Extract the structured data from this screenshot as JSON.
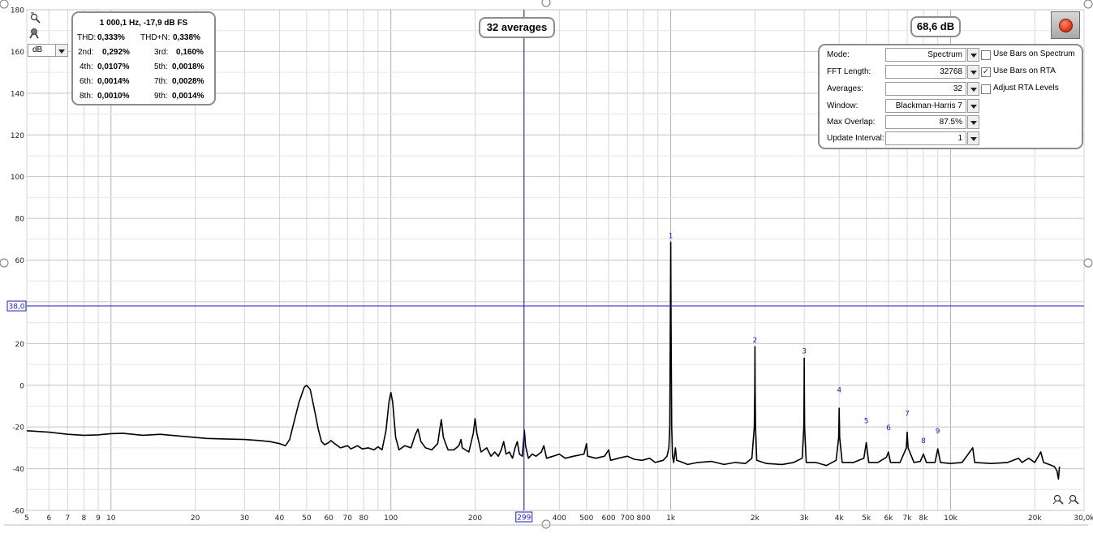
{
  "stats": {
    "title": "1 000,1 Hz, -17,9 dB FS",
    "rows": [
      {
        "l1": "THD:",
        "v1": "0,333%",
        "l2": "THD+N:",
        "v2": "0,338%"
      },
      {
        "l1": "2nd:",
        "v1": "0,292%",
        "l2": "3rd:",
        "v2": "0,160%"
      },
      {
        "l1": "4th:",
        "v1": "0,0107%",
        "l2": "5th:",
        "v2": "0,0018%"
      },
      {
        "l1": "6th:",
        "v1": "0,0014%",
        "l2": "7th:",
        "v2": "0,0028%"
      },
      {
        "l1": "8th:",
        "v1": "0,0010%",
        "l2": "9th:",
        "v2": "0,0014%"
      }
    ]
  },
  "averages_label": "32 averages",
  "level_label": "68,6 dB",
  "unit_select": "dB",
  "settings": {
    "mode": {
      "label": "Mode:",
      "value": "Spectrum"
    },
    "fft_length": {
      "label": "FFT Length:",
      "value": "32768"
    },
    "averages": {
      "label": "Averages:",
      "value": "32"
    },
    "window": {
      "label": "Window:",
      "value": "Blackman-Harris 7"
    },
    "max_overlap": {
      "label": "Max Overlap:",
      "value": "87.5%"
    },
    "update_interval": {
      "label": "Update Interval:",
      "value": "1"
    },
    "use_bars_spectrum": {
      "label": "Use Bars on Spectrum",
      "checked": false
    },
    "use_bars_rta": {
      "label": "Use Bars on RTA",
      "checked": true
    },
    "adjust_rta": {
      "label": "Adjust RTA Levels",
      "checked": false
    }
  },
  "cursor": {
    "x_label": "299",
    "y_label": "38,0",
    "x_value": 299,
    "y_value": 38.0
  },
  "chart_data": {
    "type": "line",
    "x_scale": "log",
    "xlim": [
      5,
      30000
    ],
    "ylim": [
      -60,
      180
    ],
    "grid": true,
    "y_ticks": [
      {
        "v": 180,
        "label": "180"
      },
      {
        "v": 160,
        "label": "160"
      },
      {
        "v": 140,
        "label": "140"
      },
      {
        "v": 120,
        "label": "120"
      },
      {
        "v": 100,
        "label": "100"
      },
      {
        "v": 80,
        "label": "80"
      },
      {
        "v": 60,
        "label": "60"
      },
      {
        "v": 20,
        "label": "20"
      },
      {
        "v": 0,
        "label": "0"
      },
      {
        "v": -20,
        "label": "-20"
      },
      {
        "v": -40,
        "label": "-40"
      },
      {
        "v": -60,
        "label": "-60"
      }
    ],
    "x_ticks": [
      {
        "v": 5,
        "label": "5"
      },
      {
        "v": 6,
        "label": "6"
      },
      {
        "v": 7,
        "label": "7"
      },
      {
        "v": 8,
        "label": "8"
      },
      {
        "v": 9,
        "label": "9"
      },
      {
        "v": 10,
        "label": "10"
      },
      {
        "v": 20,
        "label": "20"
      },
      {
        "v": 30,
        "label": "30"
      },
      {
        "v": 40,
        "label": "40"
      },
      {
        "v": 50,
        "label": "50"
      },
      {
        "v": 60,
        "label": "60"
      },
      {
        "v": 70,
        "label": "70"
      },
      {
        "v": 80,
        "label": "80"
      },
      {
        "v": 100,
        "label": "100"
      },
      {
        "v": 200,
        "label": "200"
      },
      {
        "v": 400,
        "label": "400"
      },
      {
        "v": 500,
        "label": "500"
      },
      {
        "v": 600,
        "label": "600"
      },
      {
        "v": 700,
        "label": "700"
      },
      {
        "v": 800,
        "label": "800"
      },
      {
        "v": 1000,
        "label": "1k"
      },
      {
        "v": 2000,
        "label": "2k"
      },
      {
        "v": 3000,
        "label": "3k"
      },
      {
        "v": 4000,
        "label": "4k"
      },
      {
        "v": 5000,
        "label": "5k"
      },
      {
        "v": 6000,
        "label": "6k"
      },
      {
        "v": 7000,
        "label": "7k"
      },
      {
        "v": 8000,
        "label": "8k"
      },
      {
        "v": 10000,
        "label": "10k"
      },
      {
        "v": 20000,
        "label": "20k"
      },
      {
        "v": 30000,
        "label": "30,0k"
      }
    ],
    "series": [
      {
        "color": "#000000",
        "points": [
          [
            5,
            -21.8
          ],
          [
            6,
            -22.5
          ],
          [
            7,
            -23.5
          ],
          [
            8,
            -24
          ],
          [
            9,
            -23.8
          ],
          [
            10,
            -23.2
          ],
          [
            11,
            -23
          ],
          [
            13,
            -24
          ],
          [
            15,
            -23.5
          ],
          [
            18,
            -24.5
          ],
          [
            22,
            -25.5
          ],
          [
            26,
            -25.8
          ],
          [
            30,
            -26
          ],
          [
            34,
            -26.5
          ],
          [
            37,
            -27
          ],
          [
            40,
            -28
          ],
          [
            42,
            -29
          ],
          [
            43.5,
            -26
          ],
          [
            45,
            -18
          ],
          [
            47,
            -8
          ],
          [
            49,
            -1
          ],
          [
            50,
            0
          ],
          [
            51.5,
            -2
          ],
          [
            53,
            -10
          ],
          [
            55,
            -21
          ],
          [
            56.5,
            -27
          ],
          [
            58,
            -28.5
          ],
          [
            60,
            -27.5
          ],
          [
            61,
            -26.5
          ],
          [
            63,
            -28
          ],
          [
            66,
            -30
          ],
          [
            70,
            -29
          ],
          [
            72,
            -30.5
          ],
          [
            76,
            -29
          ],
          [
            79,
            -30.5
          ],
          [
            83,
            -30
          ],
          [
            87,
            -31
          ],
          [
            90,
            -29.5
          ],
          [
            93,
            -31
          ],
          [
            96,
            -22
          ],
          [
            98.5,
            -8
          ],
          [
            100,
            -3.5
          ],
          [
            101.5,
            -8
          ],
          [
            104,
            -25
          ],
          [
            107,
            -31
          ],
          [
            112,
            -29
          ],
          [
            118,
            -30
          ],
          [
            122,
            -24
          ],
          [
            125,
            -21
          ],
          [
            128,
            -27
          ],
          [
            133,
            -30
          ],
          [
            140,
            -31
          ],
          [
            147,
            -28
          ],
          [
            150,
            -20
          ],
          [
            151.5,
            -16.5
          ],
          [
            154,
            -25
          ],
          [
            160,
            -31
          ],
          [
            168,
            -31
          ],
          [
            175,
            -29
          ],
          [
            178,
            -26
          ],
          [
            180,
            -30
          ],
          [
            190,
            -32
          ],
          [
            197,
            -23
          ],
          [
            200,
            -16
          ],
          [
            203,
            -23
          ],
          [
            210,
            -32
          ],
          [
            220,
            -30
          ],
          [
            228,
            -34
          ],
          [
            235,
            -32
          ],
          [
            242,
            -34
          ],
          [
            248,
            -31
          ],
          [
            253,
            -27
          ],
          [
            258,
            -33
          ],
          [
            265,
            -32
          ],
          [
            272,
            -35
          ],
          [
            278,
            -30
          ],
          [
            283,
            -27
          ],
          [
            288,
            -33
          ],
          [
            295,
            -34
          ],
          [
            300,
            -21.5
          ],
          [
            303,
            -29
          ],
          [
            310,
            -35
          ],
          [
            320,
            -33
          ],
          [
            330,
            -34
          ],
          [
            345,
            -32
          ],
          [
            352,
            -29
          ],
          [
            360,
            -35
          ],
          [
            380,
            -34
          ],
          [
            400,
            -33
          ],
          [
            420,
            -35
          ],
          [
            450,
            -34
          ],
          [
            490,
            -33
          ],
          [
            500,
            -28
          ],
          [
            505,
            -34
          ],
          [
            540,
            -35
          ],
          [
            580,
            -34
          ],
          [
            600,
            -31
          ],
          [
            610,
            -36
          ],
          [
            650,
            -35
          ],
          [
            700,
            -34
          ],
          [
            740,
            -35.5
          ],
          [
            790,
            -36
          ],
          [
            840,
            -35
          ],
          [
            880,
            -37
          ],
          [
            940,
            -36
          ],
          [
            970,
            -34
          ],
          [
            985,
            -30
          ],
          [
            992,
            -20
          ],
          [
            997,
            30
          ],
          [
            1000,
            68.6
          ],
          [
            1003,
            30
          ],
          [
            1008,
            -20
          ],
          [
            1015,
            -34
          ],
          [
            1025,
            -37
          ],
          [
            1040,
            -30
          ],
          [
            1050,
            -36
          ],
          [
            1080,
            -36.5
          ],
          [
            1150,
            -38
          ],
          [
            1250,
            -37
          ],
          [
            1400,
            -36.5
          ],
          [
            1550,
            -38
          ],
          [
            1700,
            -37
          ],
          [
            1850,
            -37.5
          ],
          [
            1950,
            -35
          ],
          [
            1990,
            -20
          ],
          [
            1997,
            0
          ],
          [
            2000,
            18.5
          ],
          [
            2003,
            0
          ],
          [
            2010,
            -20
          ],
          [
            2030,
            -36
          ],
          [
            2200,
            -37.5
          ],
          [
            2500,
            -38
          ],
          [
            2750,
            -37
          ],
          [
            2950,
            -35
          ],
          [
            2990,
            -20
          ],
          [
            2997,
            0
          ],
          [
            3000,
            13
          ],
          [
            3003,
            0
          ],
          [
            3010,
            -20
          ],
          [
            3050,
            -37
          ],
          [
            3300,
            -37
          ],
          [
            3600,
            -38.5
          ],
          [
            3900,
            -36
          ],
          [
            3985,
            -25
          ],
          [
            4000,
            -11
          ],
          [
            4015,
            -25
          ],
          [
            4100,
            -37
          ],
          [
            4500,
            -37
          ],
          [
            4900,
            -35
          ],
          [
            5000,
            -27.5
          ],
          [
            5100,
            -37
          ],
          [
            5500,
            -37
          ],
          [
            5900,
            -34.5
          ],
          [
            6000,
            -32
          ],
          [
            6100,
            -37
          ],
          [
            6600,
            -37
          ],
          [
            6950,
            -30
          ],
          [
            7000,
            -22.5
          ],
          [
            7050,
            -30
          ],
          [
            7400,
            -37
          ],
          [
            7800,
            -36.5
          ],
          [
            8000,
            -33
          ],
          [
            8200,
            -37
          ],
          [
            8800,
            -37
          ],
          [
            9000,
            -30.5
          ],
          [
            9200,
            -37
          ],
          [
            10000,
            -37.5
          ],
          [
            11000,
            -37
          ],
          [
            12000,
            -30
          ],
          [
            12200,
            -37
          ],
          [
            14000,
            -37.5
          ],
          [
            16000,
            -37
          ],
          [
            17500,
            -35
          ],
          [
            18000,
            -37
          ],
          [
            19000,
            -35
          ],
          [
            20000,
            -37
          ],
          [
            21000,
            -32
          ],
          [
            21500,
            -37
          ],
          [
            22500,
            -38
          ],
          [
            23500,
            -39
          ],
          [
            24000,
            -41
          ],
          [
            24300,
            -45
          ],
          [
            24500,
            -39
          ]
        ]
      }
    ],
    "harmonic_markers": [
      {
        "label": "1",
        "x": 1000,
        "y": 68.6
      },
      {
        "label": "2",
        "x": 2000,
        "y": 18.5
      },
      {
        "label": "3",
        "x": 3000,
        "y": 13.4
      },
      {
        "label": "4",
        "x": 4000,
        "y": -5.3
      },
      {
        "label": "5",
        "x": 5000,
        "y": -20.2
      },
      {
        "label": "6",
        "x": 6000,
        "y": -23.4
      },
      {
        "label": "7",
        "x": 7000,
        "y": -16.6
      },
      {
        "label": "8",
        "x": 8000,
        "y": -29.6
      },
      {
        "label": "9",
        "x": 9000,
        "y": -24.9
      }
    ],
    "colors": {
      "grid": "#c9c9c9",
      "cursor": "#1a1acc",
      "marker": "#1a1acc",
      "trace": "#000000"
    }
  }
}
